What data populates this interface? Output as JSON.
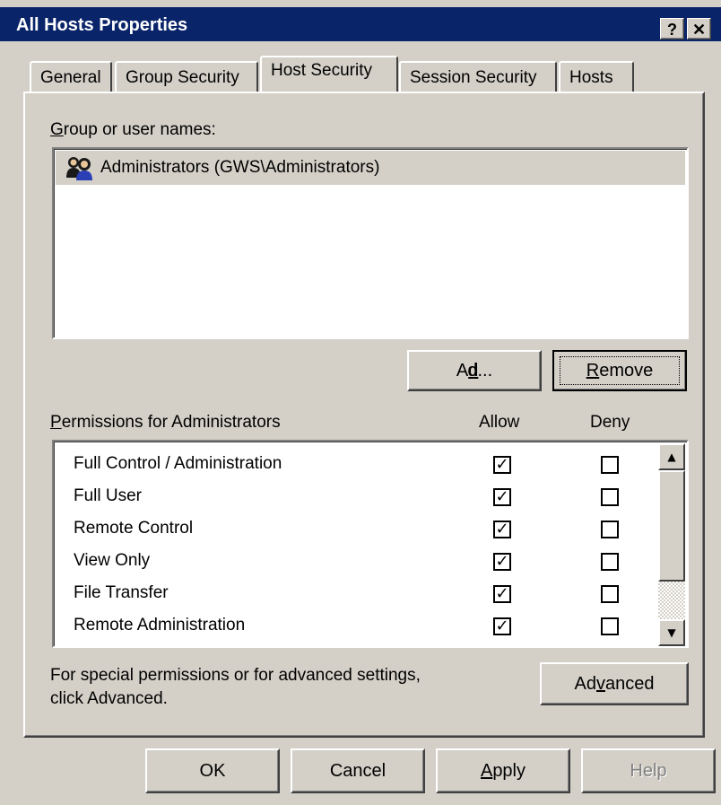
{
  "window": {
    "title": "All Hosts Properties",
    "help_btn": "?",
    "close_btn": "✕"
  },
  "tabs": [
    {
      "label": "General"
    },
    {
      "label": "Group Security"
    },
    {
      "label": "Host Security"
    },
    {
      "label": "Session Security"
    },
    {
      "label": "Hosts"
    }
  ],
  "active_tab": "Host Security",
  "group_section": {
    "label_underline": "G",
    "label_rest": "roup or user names:",
    "users": [
      {
        "name": "Administrators (GWS\\Administrators)",
        "icon": "user-group-icon",
        "selected": true
      }
    ]
  },
  "buttons": {
    "add_pre": "A",
    "add_u": "d",
    "add_post": "d...",
    "remove_u": "R",
    "remove_post": "emove",
    "advanced_pre": "Ad",
    "advanced_u": "v",
    "advanced_post": "anced",
    "ok": "OK",
    "cancel": "Cancel",
    "apply_u": "A",
    "apply_post": "pply",
    "help": "Help"
  },
  "permissions": {
    "label_underline": "P",
    "label_rest": "ermissions for Administrators",
    "allow_header": "Allow",
    "deny_header": "Deny",
    "rows": [
      {
        "name": "Full Control / Administration",
        "allow": "✓",
        "deny": ""
      },
      {
        "name": "Full User",
        "allow": "✓",
        "deny": ""
      },
      {
        "name": "Remote Control",
        "allow": "✓",
        "deny": ""
      },
      {
        "name": "View Only",
        "allow": "✓",
        "deny": ""
      },
      {
        "name": "File Transfer",
        "allow": "✓",
        "deny": ""
      },
      {
        "name": "Remote Administration",
        "allow": "✓",
        "deny": ""
      }
    ]
  },
  "advanced_note": {
    "line1": "For special permissions or for advanced settings,",
    "line2": "click Advanced."
  },
  "scroll": {
    "up_arrow": "▲",
    "down_arrow": "▼"
  }
}
